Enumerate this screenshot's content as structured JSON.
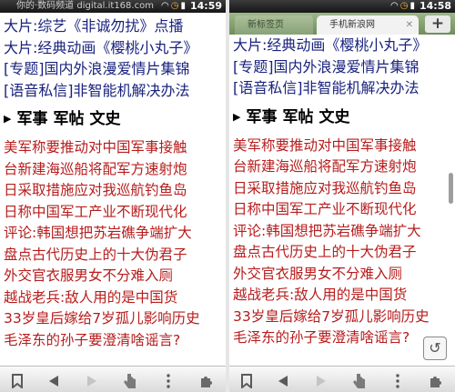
{
  "watermark": "你的·数码频道 digital.it168.com",
  "status": {
    "left_time": "14:59",
    "right_time": "14:58"
  },
  "tabs": {
    "inactive": "新标签页",
    "active": "手机新浪网"
  },
  "ent_links": [
    "大片:综艺《非诚勿扰》点播",
    "大片:经典动画《樱桃小丸子》",
    "[专题]国内外浪漫爱情片集锦",
    "[语音私信]非智能机解决办法"
  ],
  "section": {
    "w1": "军事",
    "w2": "军帖",
    "w3": "文史"
  },
  "news": [
    "美军称要推动对中国军事接触",
    "台新建海巡船将配军方速射炮",
    "日采取措施应对我巡航钓鱼岛",
    "日称中国军工产业不断现代化",
    "评论:韩国想把苏岩礁争端扩大",
    "盘点古代历史上的十大伪君子",
    "外交官衣服男女不分难入厕",
    "越战老兵:敌人用的是中国货",
    "33岁皇后嫁给7岁孤儿影响历史",
    "毛泽东的孙子要澄清啥谣言?"
  ],
  "icons": {
    "bookmark": "bookmark-icon",
    "back": "back-arrow-icon",
    "forward": "forward-arrow-icon",
    "pointer": "hand-pointer-icon",
    "menu": "menu-dots-icon",
    "plugin": "puzzle-icon",
    "reload": "reload-icon",
    "plus": "plus-icon"
  },
  "colors": {
    "link_blue": "#1a237e",
    "news_red": "#b71c1c",
    "tabbar_green": "#7f9d6a"
  }
}
